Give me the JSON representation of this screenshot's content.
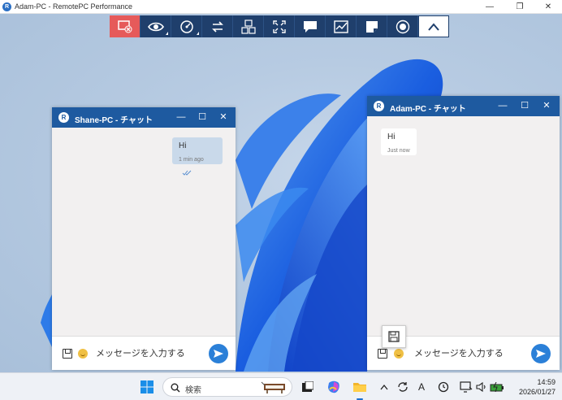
{
  "window": {
    "title": "Adam-PC - RemotePC Performance",
    "logo_letter": "R",
    "minimize": "—",
    "maximize": "❐",
    "close": "✕"
  },
  "toolbar": {
    "items": [
      {
        "name": "disconnect-icon",
        "color": "#e65a5a"
      },
      {
        "name": "view-icon"
      },
      {
        "name": "performance-icon"
      },
      {
        "name": "file-transfer-icon"
      },
      {
        "name": "keyboard-shortcut-icon"
      },
      {
        "name": "fullscreen-icon"
      },
      {
        "name": "chat-icon"
      },
      {
        "name": "whiteboard-icon"
      },
      {
        "name": "sticky-note-icon"
      },
      {
        "name": "record-icon"
      },
      {
        "name": "collapse-chevron-icon"
      }
    ]
  },
  "chat_left": {
    "title_en": "Shane-PC",
    "title_sep": " - ",
    "title_jp": "チャット",
    "message": {
      "text": "Hi",
      "time": "1 min ago",
      "status_icon": "double-check-icon"
    },
    "input_placeholder": "メッセージを入力する"
  },
  "chat_right": {
    "title_en": "Adam-PC",
    "title_sep": " - ",
    "title_jp": "チャット",
    "message": {
      "text": "Hi",
      "time": "Just now"
    },
    "input_placeholder": "メッセージを入力する"
  },
  "taskbar": {
    "search_placeholder": "検索",
    "clock_time": "14:59",
    "clock_date": "2026/01/27",
    "ime_label": "A"
  },
  "colors": {
    "chat_header": "#1e5aa0",
    "toolbar": "#1f3f6c",
    "send_button": "#2b80d8"
  }
}
